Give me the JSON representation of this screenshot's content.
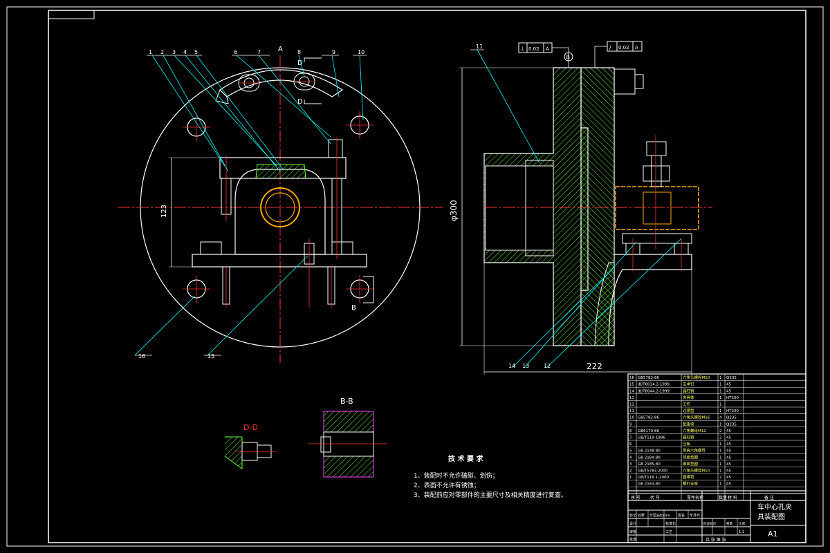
{
  "drawing": {
    "title_block": {
      "drawing_title_line1": "车中心孔夹",
      "drawing_title_line2": "具装配图",
      "sheet_size": "A1",
      "scale": "1:1",
      "sheet_info": "共  张  第  张"
    },
    "section_labels": {
      "b_b": "B-B",
      "d_d": "D-D",
      "a_mark": "A",
      "b_mark": "B",
      "d_mark": "D",
      "b_circle": "B"
    },
    "dimensions": {
      "diameter": "φ300",
      "length": "222",
      "height": "123"
    },
    "tolerance_frames": [
      {
        "sym": "⊥",
        "val": "0.02",
        "ref": "A"
      },
      {
        "sym": "∕",
        "val": "0.02",
        "ref": "A"
      }
    ],
    "part_balloons_left": [
      "1",
      "2",
      "3",
      "4",
      "5",
      "6",
      "7",
      "8",
      "9",
      "10"
    ],
    "part_balloons_bottom": [
      "16",
      "15"
    ],
    "part_balloons_right": [
      "11",
      "14",
      "13",
      "12"
    ],
    "tech_requirements": {
      "heading": "技 术 要 求",
      "items": [
        "1、装配时不允许磕碰、划伤；",
        "2、表面不允许有锈蚀；",
        "3、装配前应对零部件的主要尺寸及相关精度进行复查。"
      ]
    },
    "bom_rows": [
      {
        "no": "16",
        "std": "GB5782-86",
        "name": "六角头螺栓M10",
        "qty": "1",
        "mat": "Q235"
      },
      {
        "no": "15",
        "std": "JB/T8014.2-1999",
        "name": "支承钉",
        "qty": "1",
        "mat": "45"
      },
      {
        "no": "14",
        "std": "JB/T8044.2-1999",
        "name": "圆柱销",
        "qty": "1",
        "mat": "45"
      },
      {
        "no": "13",
        "std": "",
        "name": "夹具体",
        "qty": "1",
        "mat": "HT200"
      },
      {
        "no": "12",
        "std": "",
        "name": "工件",
        "qty": "1",
        "mat": ""
      },
      {
        "no": "11",
        "std": "",
        "name": "过渡盘",
        "qty": "1",
        "mat": "HT200"
      },
      {
        "no": "10",
        "std": "GB5782-86",
        "name": "六角头螺栓M16",
        "qty": "4",
        "mat": "Q235"
      },
      {
        "no": "9",
        "std": "",
        "name": "配重块",
        "qty": "1",
        "mat": "Q235"
      },
      {
        "no": "8",
        "std": "GB6170-86",
        "name": "六角螺母M12",
        "qty": "2",
        "mat": "45"
      },
      {
        "no": "7",
        "std": "GB/T119-1986",
        "name": "圆柱销",
        "qty": "2",
        "mat": "45"
      },
      {
        "no": "6",
        "std": "",
        "name": "压板",
        "qty": "1",
        "mat": "45"
      },
      {
        "no": "5",
        "std": "GB 2148-80",
        "name": "带肩六角螺母",
        "qty": "1",
        "mat": "45"
      },
      {
        "no": "4",
        "std": "GB 2184-80",
        "name": "球面垫圈",
        "qty": "1",
        "mat": "45"
      },
      {
        "no": "3",
        "std": "GB 2185-80",
        "name": "锥面垫圈",
        "qty": "1",
        "mat": "45"
      },
      {
        "no": "2",
        "std": "GB/T5783-2000",
        "name": "六角头螺栓M10",
        "qty": "1",
        "mat": "45"
      },
      {
        "no": "1",
        "std": "GB/T118.1-2000",
        "name": "圆锥销",
        "qty": "2",
        "mat": "45"
      },
      {
        "no": "",
        "std": "GB 2163-80",
        "name": "螺钉支座",
        "qty": "1",
        "mat": "45"
      }
    ],
    "bom_header": {
      "no": "序 号",
      "std": "代 号",
      "name": "零件名称",
      "qty": "数量",
      "mat": "材 料",
      "remark": "备 注"
    },
    "title_block_labels": {
      "row1": [
        "标记",
        "处数",
        "分区",
        "更改文件号",
        "签名",
        "年月日"
      ],
      "row2": [
        "设计",
        "",
        "标准化"
      ],
      "row3": [
        "审核",
        "",
        "工艺"
      ],
      "row4": [
        "批准"
      ],
      "stage": [
        "阶段标记",
        "重量",
        "比例"
      ]
    },
    "colors": {
      "background": "#000000",
      "frame": "#ffffff",
      "centerline": "#ff0000",
      "leader": "#00ffff",
      "hatch_green": "#66ff33",
      "workpiece": "#ffaa00",
      "section_magenta": "#ff44ff"
    }
  }
}
